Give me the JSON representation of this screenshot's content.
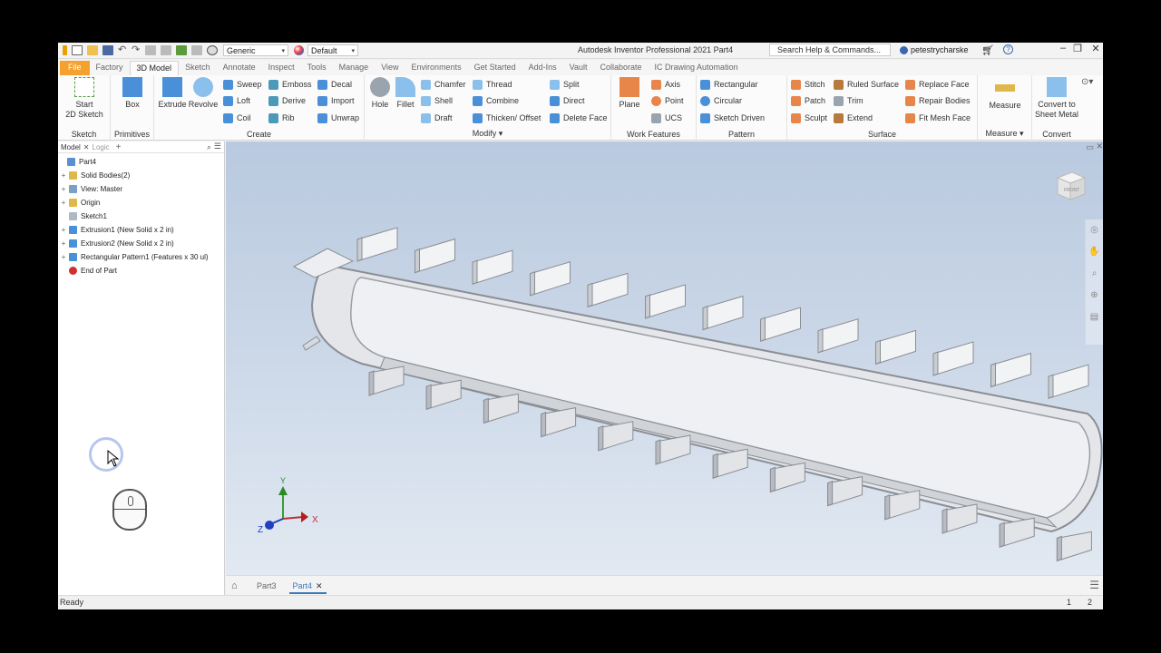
{
  "titlebar": {
    "material": "Generic",
    "appearance": "Default",
    "app_title": "Autodesk Inventor Professional 2021   Part4",
    "search_placeholder": "Search Help & Commands...",
    "user": "petestrycharske"
  },
  "tabs": [
    "File",
    "Factory",
    "3D Model",
    "Sketch",
    "Annotate",
    "Inspect",
    "Tools",
    "Manage",
    "View",
    "Environments",
    "Get Started",
    "Add-Ins",
    "Vault",
    "Collaborate",
    "IC Drawing Automation"
  ],
  "active_tab": "3D Model",
  "ribbon": {
    "sketch": {
      "label": "Sketch",
      "start_line1": "Start",
      "start_line2": "2D Sketch"
    },
    "primitives": {
      "label": "Primitives",
      "box": "Box"
    },
    "create": {
      "label": "Create",
      "extrude": "Extrude",
      "revolve": "Revolve",
      "sweep": "Sweep",
      "loft": "Loft",
      "coil": "Coil",
      "emboss": "Emboss",
      "derive": "Derive",
      "rib": "Rib",
      "decal": "Decal",
      "import": "Import",
      "unwrap": "Unwrap"
    },
    "modify": {
      "label": "Modify",
      "hole": "Hole",
      "fillet": "Fillet",
      "chamfer": "Chamfer",
      "shell": "Shell",
      "draft": "Draft",
      "thread": "Thread",
      "combine": "Combine",
      "thicken": "Thicken/ Offset",
      "split": "Split",
      "direct": "Direct",
      "delete_face": "Delete Face"
    },
    "work_features": {
      "label": "Work Features",
      "plane": "Plane",
      "axis": "Axis",
      "point": "Point",
      "ucs": "UCS"
    },
    "pattern": {
      "label": "Pattern",
      "rectangular": "Rectangular",
      "circular": "Circular",
      "sketch_driven": "Sketch Driven"
    },
    "surface": {
      "label": "Surface",
      "stitch": "Stitch",
      "patch": "Patch",
      "sculpt": "Sculpt",
      "ruled": "Ruled Surface",
      "trim": "Trim",
      "extend": "Extend",
      "replace": "Replace Face",
      "repair": "Repair Bodies",
      "fit_mesh": "Fit Mesh Face"
    },
    "measure": {
      "label": "Measure",
      "measure": "Measure"
    },
    "convert": {
      "label": "Convert",
      "line1": "Convert to",
      "line2": "Sheet Metal"
    }
  },
  "browser": {
    "tab_model": "Model",
    "tab_logic": "Logic",
    "tree": [
      {
        "label": "Part4",
        "expand": "",
        "color": "#5a8fd0"
      },
      {
        "label": "Solid Bodies(2)",
        "expand": "+",
        "color": "#e0b84a"
      },
      {
        "label": "View: Master",
        "expand": "+",
        "color": "#7aa0c8"
      },
      {
        "label": "Origin",
        "expand": "+",
        "color": "#e0b84a"
      },
      {
        "label": "Sketch1",
        "expand": "",
        "color": "#b0b8c4"
      },
      {
        "label": "Extrusion1 (New Solid x 2 in)",
        "expand": "+",
        "color": "#4a90d9"
      },
      {
        "label": "Extrusion2 (New Solid x 2 in)",
        "expand": "+",
        "color": "#4a90d9"
      },
      {
        "label": "Rectangular Pattern1 (Features x 30 ul)",
        "expand": "+",
        "color": "#4a90d9"
      },
      {
        "label": "End of Part",
        "expand": "",
        "color": "#d23030"
      }
    ]
  },
  "viewcube_label": "FRONT",
  "triad": {
    "x": "X",
    "y": "Y",
    "z": "Z"
  },
  "doc_tabs": [
    "Part3",
    "Part4"
  ],
  "active_doc": "Part4",
  "status": {
    "text": "Ready",
    "count1": "1",
    "count2": "2"
  }
}
